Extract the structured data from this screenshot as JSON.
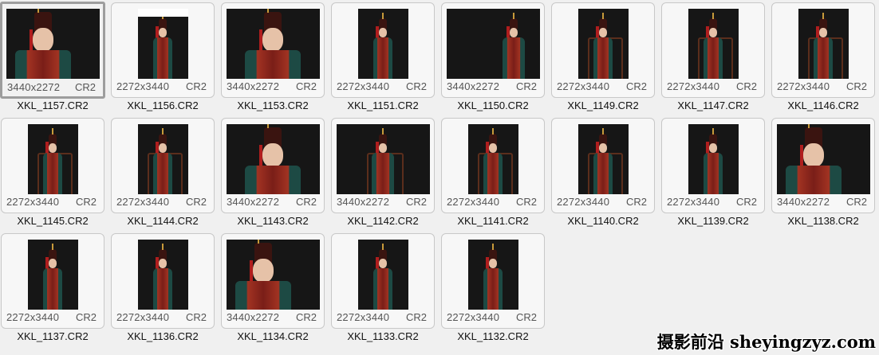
{
  "files": [
    {
      "name": "XKL_1157.CR2",
      "dims": "3440x2272",
      "ext": "CR2",
      "orientation": "landscape",
      "selected": true
    },
    {
      "name": "XKL_1156.CR2",
      "dims": "2272x3440",
      "ext": "CR2",
      "orientation": "portrait",
      "whitebar": true
    },
    {
      "name": "XKL_1153.CR2",
      "dims": "3440x2272",
      "ext": "CR2",
      "orientation": "landscape"
    },
    {
      "name": "XKL_1151.CR2",
      "dims": "2272x3440",
      "ext": "CR2",
      "orientation": "portrait"
    },
    {
      "name": "XKL_1150.CR2",
      "dims": "3440x2272",
      "ext": "CR2",
      "orientation": "landscape"
    },
    {
      "name": "XKL_1149.CR2",
      "dims": "2272x3440",
      "ext": "CR2",
      "orientation": "portrait",
      "seated": true
    },
    {
      "name": "XKL_1147.CR2",
      "dims": "2272x3440",
      "ext": "CR2",
      "orientation": "portrait",
      "seated": true
    },
    {
      "name": "XKL_1146.CR2",
      "dims": "2272x3440",
      "ext": "CR2",
      "orientation": "portrait",
      "seated": true
    },
    {
      "name": "XKL_1145.CR2",
      "dims": "2272x3440",
      "ext": "CR2",
      "orientation": "portrait",
      "seated": true
    },
    {
      "name": "XKL_1144.CR2",
      "dims": "2272x3440",
      "ext": "CR2",
      "orientation": "portrait",
      "seated": true
    },
    {
      "name": "XKL_1143.CR2",
      "dims": "3440x2272",
      "ext": "CR2",
      "orientation": "landscape"
    },
    {
      "name": "XKL_1142.CR2",
      "dims": "3440x2272",
      "ext": "CR2",
      "orientation": "landscape",
      "seated": true
    },
    {
      "name": "XKL_1141.CR2",
      "dims": "2272x3440",
      "ext": "CR2",
      "orientation": "portrait",
      "seated": true
    },
    {
      "name": "XKL_1140.CR2",
      "dims": "2272x3440",
      "ext": "CR2",
      "orientation": "portrait",
      "seated": true
    },
    {
      "name": "XKL_1139.CR2",
      "dims": "2272x3440",
      "ext": "CR2",
      "orientation": "portrait"
    },
    {
      "name": "XKL_1138.CR2",
      "dims": "3440x2272",
      "ext": "CR2",
      "orientation": "landscape"
    },
    {
      "name": "XKL_1137.CR2",
      "dims": "2272x3440",
      "ext": "CR2",
      "orientation": "portrait"
    },
    {
      "name": "XKL_1136.CR2",
      "dims": "2272x3440",
      "ext": "CR2",
      "orientation": "portrait"
    },
    {
      "name": "XKL_1134.CR2",
      "dims": "3440x2272",
      "ext": "CR2",
      "orientation": "landscape"
    },
    {
      "name": "XKL_1133.CR2",
      "dims": "2272x3440",
      "ext": "CR2",
      "orientation": "portrait"
    },
    {
      "name": "XKL_1132.CR2",
      "dims": "2272x3440",
      "ext": "CR2",
      "orientation": "portrait"
    }
  ],
  "watermark": "摄影前沿 sheyingzyz.com"
}
